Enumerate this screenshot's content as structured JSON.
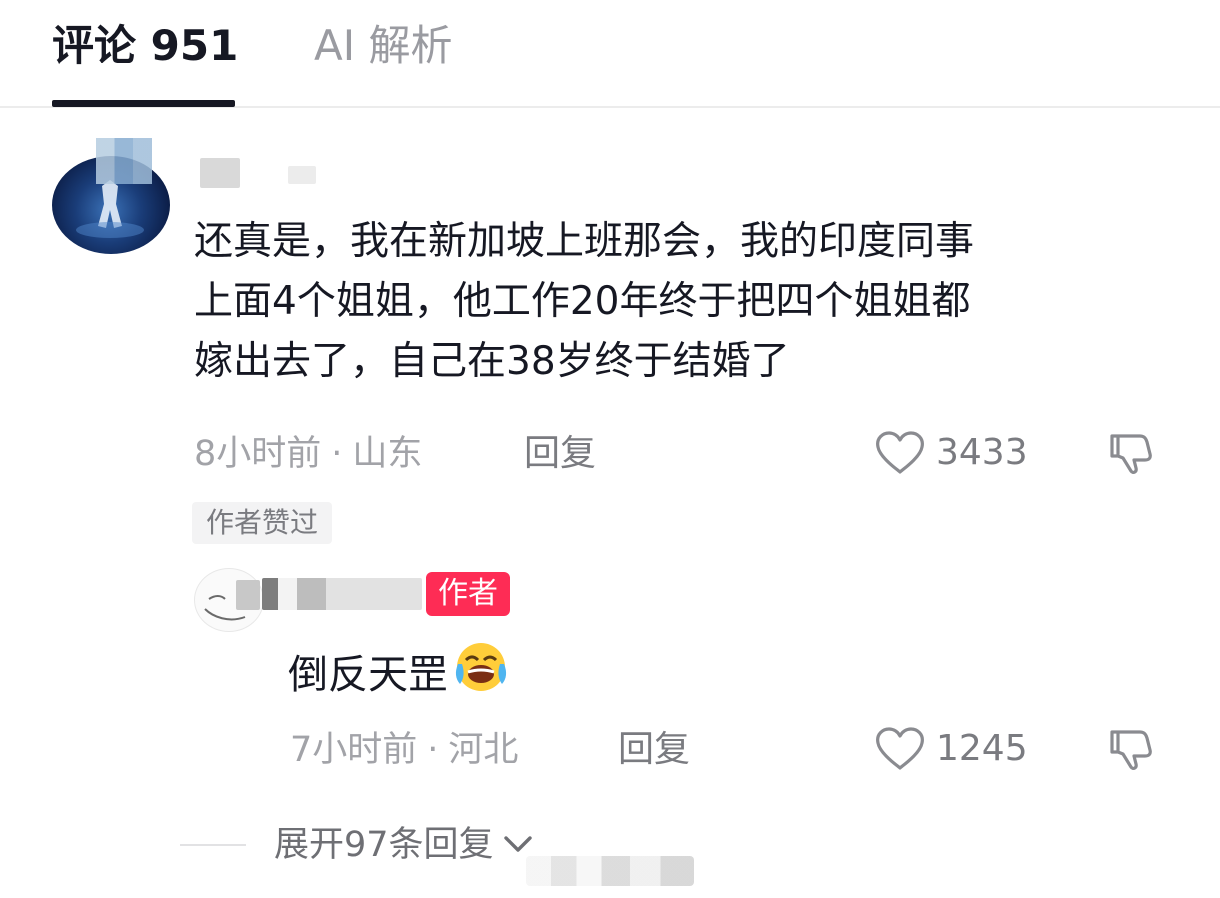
{
  "tabs": {
    "comments_label": "评论 951",
    "ai_label": "AI 解析"
  },
  "comment": {
    "lines": [
      "还真是，我在新加坡上班那会，我的印度同事",
      "上面4个姐姐，他工作20年终于把四个姐姐都",
      "嫁出去了，自己在38岁终于结婚了"
    ],
    "time": "8小时前",
    "separator": "·",
    "location": "山东",
    "reply_label": "回复",
    "like_count": "3433",
    "author_liked": "作者赞过"
  },
  "reply": {
    "author_badge": "作者",
    "text": "倒反天罡",
    "emoji": "loudly-crying-laughing-emoji",
    "time": "7小时前",
    "separator": "·",
    "location": "河北",
    "reply_label": "回复",
    "like_count": "1245"
  },
  "expand": {
    "label": "展开97条回复"
  },
  "icons": {
    "like": "heart-outline-icon",
    "dislike": "thumbs-down-icon",
    "chevron": "chevron-down-icon"
  },
  "colors": {
    "text": "#161823",
    "secondary": "#a2a3a8",
    "action": "#7a7b80",
    "author_badge": "#fe2c55"
  }
}
